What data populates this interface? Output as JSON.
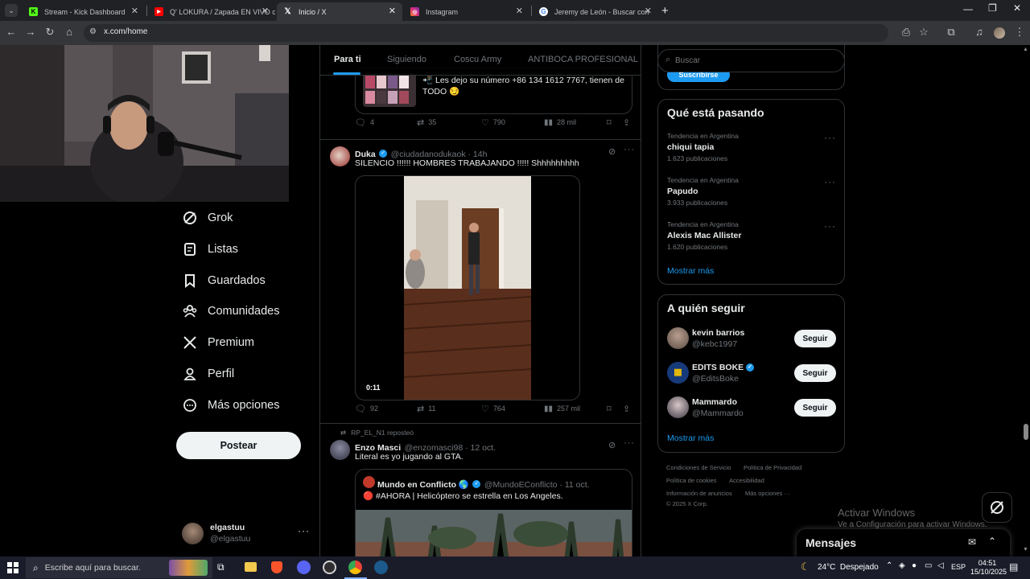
{
  "browser": {
    "tabs": [
      {
        "title": "Stream - Kick Dashboard",
        "icon": "kick-icon",
        "color": "#53fc18"
      },
      {
        "title": "Q' LOKURA / Zapada EN VIVO c",
        "icon": "youtube-icon",
        "color": "#ff0000"
      },
      {
        "title": "Inicio / X",
        "icon": "x-logo-icon",
        "color": "#ffffff",
        "active": true
      },
      {
        "title": "Instagram",
        "icon": "instagram-icon",
        "color": "#e1306c"
      },
      {
        "title": "Jeremy de León - Buscar con G",
        "icon": "google-icon",
        "color": "#ffffff"
      }
    ],
    "url": "x.com/home"
  },
  "nav": {
    "items": [
      {
        "label": "Grok",
        "icon": "grok-icon"
      },
      {
        "label": "Listas",
        "icon": "lists-icon"
      },
      {
        "label": "Guardados",
        "icon": "bookmark-icon"
      },
      {
        "label": "Comunidades",
        "icon": "communities-icon"
      },
      {
        "label": "Premium",
        "icon": "x-logo-icon"
      },
      {
        "label": "Perfil",
        "icon": "profile-icon"
      },
      {
        "label": "Más opciones",
        "icon": "more-options-icon"
      }
    ],
    "post_label": "Postear",
    "account": {
      "name": "elgastuu",
      "handle": "@elgastuu"
    }
  },
  "feed": {
    "tabs": [
      "Para ti",
      "Siguiendo",
      "Coscu Army",
      "ANTIBOCA PROFESIONAL"
    ],
    "active_tab": "Para ti",
    "tweet0": {
      "text_line1": "📲 Les dejo su número +86 134 1612 7767, tienen de",
      "text_line2": "TODO 😏",
      "replies": "4",
      "reposts": "35",
      "likes": "790",
      "views": "28 mil"
    },
    "tweet1": {
      "name": "Duka",
      "handle": "@ciudadanodukaok · 14h",
      "text": "SILENCIO !!!!!! HOMBRES TRABAJANDO !!!!! Shhhhhhhhh",
      "video_time": "0:11",
      "replies": "92",
      "reposts": "11",
      "likes": "764",
      "views": "257 mil"
    },
    "tweet2": {
      "repost_note": "RP_EL_N1 reposteó",
      "name": "Enzo Masci",
      "handle": "@enzomasci98 · 12 oct.",
      "text": "Literal es yo jugando al GTA.",
      "quote_name": "Mundo en Conflicto 🌎",
      "quote_handle": "@MundoEConflicto · 11 oct.",
      "quote_text": "🔴 #AHORA | Helicóptero se estrella en Los Angeles."
    }
  },
  "sidebar": {
    "search_placeholder": "Buscar",
    "subscribe_label": "Suscribirse",
    "trending": {
      "title": "Qué está pasando",
      "items": [
        {
          "meta": "Tendencia en Argentina",
          "name": "chiqui tapia",
          "count": "1.623 publicaciones"
        },
        {
          "meta": "Tendencia en Argentina",
          "name": "Papudo",
          "count": "3.933 publicaciones"
        },
        {
          "meta": "Tendencia en Argentina",
          "name": "Alexis Mac Allister",
          "count": "1.620 publicaciones"
        }
      ],
      "more": "Mostrar más"
    },
    "who_to_follow": {
      "title": "A quién seguir",
      "users": [
        {
          "name": "kevin barrios",
          "handle": "@kebc1997",
          "button": "Seguir"
        },
        {
          "name": "EDITS BOKE",
          "handle": "@EditsBoke",
          "button": "Seguir"
        },
        {
          "name": "Mammardo",
          "handle": "@Mammardo",
          "button": "Seguir"
        }
      ],
      "more": "Mostrar más"
    },
    "footer": {
      "links": [
        "Condiciones de Servicio",
        "Política de Privacidad",
        "Política de cookies",
        "Accesibilidad",
        "Información de anuncios",
        "Más opciones ···"
      ],
      "copyright": "© 2025 X Corp."
    }
  },
  "windows_watermark": {
    "line1": "Activar Windows",
    "line2": "Ve a Configuración para activar Windows."
  },
  "messages": {
    "label": "Mensajes"
  },
  "taskbar": {
    "search_placeholder": "Escribe aquí para buscar.",
    "weather": "24°C  Despejado",
    "lang": "ESP",
    "time": "04:51",
    "date": "15/10/2025"
  }
}
